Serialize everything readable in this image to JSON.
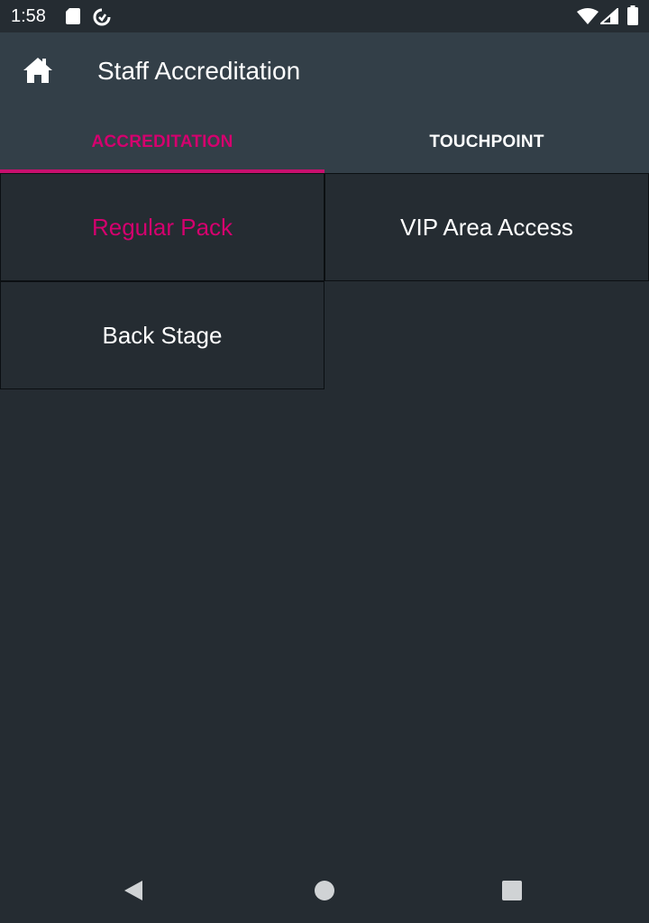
{
  "status_bar": {
    "time": "1:58",
    "icons": [
      "sd-card-icon",
      "data-saver-icon",
      "wifi-icon",
      "cell-signal-icon",
      "battery-icon"
    ]
  },
  "app_bar": {
    "home_icon": "home-icon",
    "title": "Staff Accreditation"
  },
  "tabs": [
    {
      "label": "ACCREDITATION",
      "selected": true
    },
    {
      "label": "TOUCHPOINT",
      "selected": false
    }
  ],
  "tiles": [
    {
      "label": "Regular Pack",
      "selected": true
    },
    {
      "label": "VIP Area Access",
      "selected": false
    },
    {
      "label": "Back Stage",
      "selected": false
    }
  ],
  "nav_bar": {
    "icons": [
      "back-icon",
      "home-circle-icon",
      "recents-icon"
    ]
  },
  "colors": {
    "background": "#252c32",
    "app_bar": "#333f48",
    "accent": "#d4006e",
    "text": "#ffffff"
  }
}
